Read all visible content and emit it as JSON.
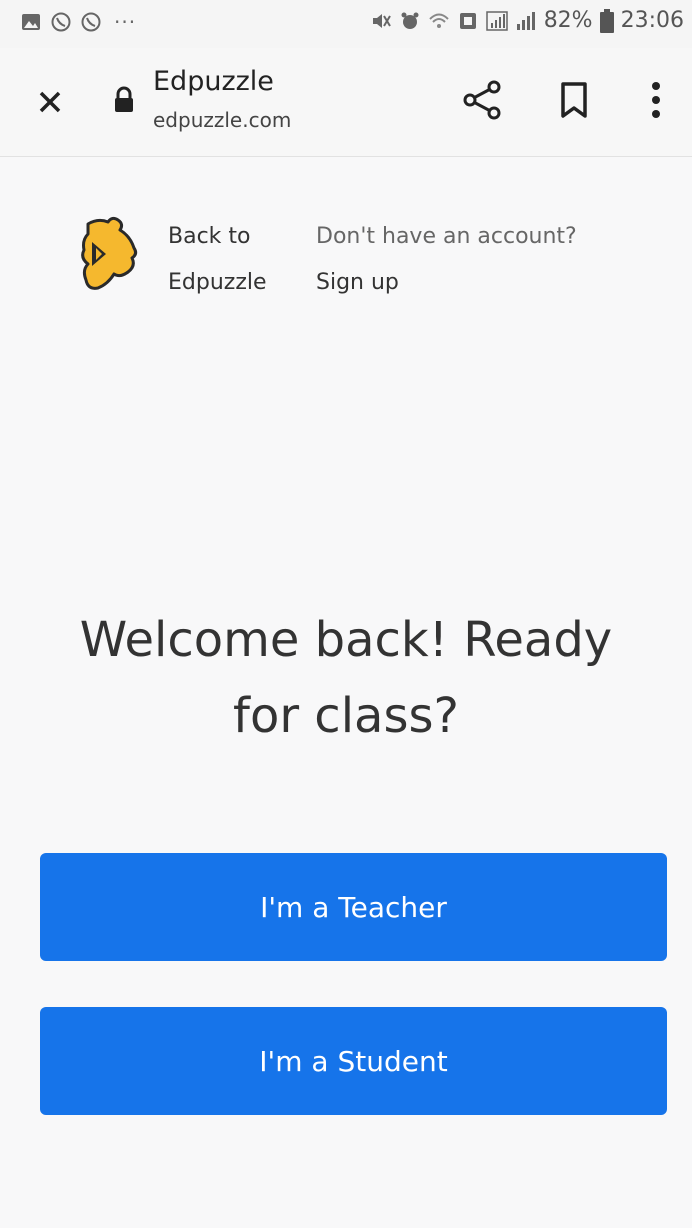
{
  "status_bar": {
    "battery": "82%",
    "time": "23:06",
    "dots": "···"
  },
  "browser": {
    "title": "Edpuzzle",
    "url": "edpuzzle.com"
  },
  "header": {
    "back_line1": "Back to",
    "back_line2": "Edpuzzle",
    "no_account": "Don't have an account?",
    "signup": "Sign up"
  },
  "main": {
    "headline_line1": "Welcome back! Ready",
    "headline_line2": "for class?",
    "teacher_button": "I'm a Teacher",
    "student_button": "I'm a Student"
  },
  "colors": {
    "accent": "#1674ea",
    "logo": "#f5b82e"
  },
  "icons": [
    "gallery-icon",
    "viber-icon",
    "viber-icon",
    "mute-icon",
    "alarm-icon",
    "wifi-icon",
    "nfc-icon",
    "signal-icon",
    "battery-icon",
    "close-icon",
    "lock-icon",
    "share-icon",
    "bookmark-icon",
    "more-vert-icon",
    "edpuzzle-logo-icon"
  ]
}
